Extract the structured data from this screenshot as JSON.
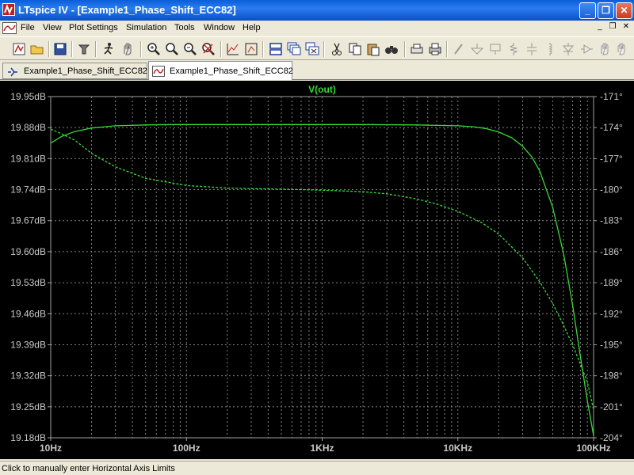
{
  "window": {
    "title": "LTspice IV - [Example1_Phase_Shift_ECC82]",
    "minimize_label": "_",
    "maximize_label": "❐",
    "close_label": "✕"
  },
  "menu": {
    "items": [
      "File",
      "View",
      "Plot Settings",
      "Simulation",
      "Tools",
      "Window",
      "Help"
    ],
    "mdi_minimize": "_",
    "mdi_restore": "❐",
    "mdi_close": "✕"
  },
  "toolbar": {
    "icons": [
      "new-schematic-icon",
      "open-icon",
      "save-icon",
      "control-panel-icon",
      "run-icon",
      "halt-icon",
      "zoom-in-icon",
      "zoom-out-icon",
      "zoom-fit-icon",
      "zoom-cancel-icon",
      "autorange-icon",
      "zoom-full-icon",
      "tile-horizontal-icon",
      "cascade-icon",
      "close-all-icon",
      "cut-icon",
      "copy-icon",
      "paste-icon",
      "find-icon",
      "print-preview-icon",
      "print-icon",
      "wire-icon",
      "ground-icon",
      "label-icon",
      "resistor-icon",
      "capacitor-icon",
      "inductor-icon",
      "diode-icon",
      "component-icon",
      "move-icon"
    ]
  },
  "tabs": [
    {
      "label": "Example1_Phase_Shift_ECC82",
      "icon": "schematic-icon",
      "active": false
    },
    {
      "label": "Example1_Phase_Shift_ECC82",
      "icon": "waveform-icon",
      "active": true
    }
  ],
  "status": {
    "text": "Click to manually enter Horizontal Axis Limits"
  },
  "colors": {
    "trace": "#38d838",
    "grid": "#808080",
    "axis_text": "#c8c8c8",
    "background": "#000000"
  },
  "chart_data": {
    "type": "line",
    "title": "V(out)",
    "x_scale": "log",
    "xlim": [
      10,
      100000
    ],
    "x_ticks": [
      10,
      100,
      1000,
      10000,
      100000
    ],
    "x_tick_labels": [
      "10Hz",
      "100Hz",
      "1KHz",
      "10KHz",
      "100KHz"
    ],
    "y_left_lim": [
      19.18,
      19.95
    ],
    "y_left_ticks": [
      19.95,
      19.88,
      19.81,
      19.74,
      19.67,
      19.6,
      19.53,
      19.46,
      19.39,
      19.32,
      19.25,
      19.18
    ],
    "y_left_tick_labels": [
      "19.95dB",
      "19.88dB",
      "19.81dB",
      "19.74dB",
      "19.67dB",
      "19.60dB",
      "19.53dB",
      "19.46dB",
      "19.39dB",
      "19.32dB",
      "19.25dB",
      "19.18dB"
    ],
    "y_right_lim": [
      -204,
      -171
    ],
    "y_right_ticks": [
      -171,
      -174,
      -177,
      -180,
      -183,
      -186,
      -189,
      -192,
      -195,
      -198,
      -201,
      -204
    ],
    "y_right_tick_labels": [
      "-171°",
      "-174°",
      "-177°",
      "-180°",
      "-183°",
      "-186°",
      "-189°",
      "-192°",
      "-195°",
      "-198°",
      "-201°",
      "-204°"
    ],
    "grid": true,
    "series": [
      {
        "name": "magnitude",
        "axis": "left",
        "style": "solid",
        "x": [
          10,
          12,
          15,
          20,
          30,
          50,
          80,
          100,
          200,
          500,
          1000,
          2000,
          5000,
          10000,
          13000,
          16000,
          20000,
          25000,
          30000,
          35000,
          40000,
          50000,
          60000,
          70000,
          80000,
          90000,
          100000
        ],
        "y": [
          19.845,
          19.86,
          19.871,
          19.879,
          19.884,
          19.886,
          19.887,
          19.887,
          19.887,
          19.887,
          19.887,
          19.887,
          19.886,
          19.884,
          19.882,
          19.878,
          19.87,
          19.857,
          19.838,
          19.814,
          19.783,
          19.7,
          19.597,
          19.48,
          19.363,
          19.263,
          19.185
        ]
      },
      {
        "name": "phase",
        "axis": "right",
        "style": "dashed",
        "x": [
          10,
          12,
          15,
          20,
          30,
          50,
          100,
          200,
          500,
          1000,
          2000,
          3000,
          5000,
          7000,
          10000,
          15000,
          20000,
          30000,
          40000,
          50000,
          60000,
          70000,
          80000,
          90000,
          100000
        ],
        "y": [
          -174.15,
          -174.6,
          -175.2,
          -176.5,
          -177.8,
          -178.9,
          -179.6,
          -179.85,
          -179.95,
          -180.05,
          -180.2,
          -180.4,
          -180.9,
          -181.4,
          -182.1,
          -183.2,
          -184.3,
          -186.6,
          -188.9,
          -191.0,
          -193.1,
          -195.0,
          -196.9,
          -198.6,
          -201.3
        ]
      }
    ]
  }
}
